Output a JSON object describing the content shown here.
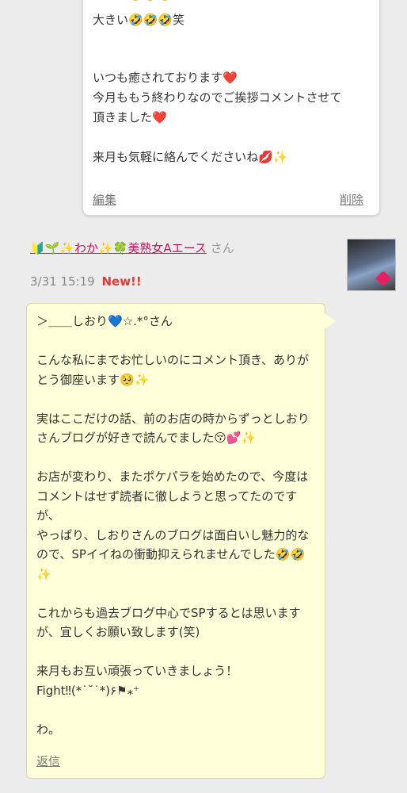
{
  "prev_comment": {
    "cut_line": "・・・🤣🤣🤣",
    "lines": [
      "大きい🤣🤣🤣笑",
      "",
      "",
      "いつも癒されております❤️",
      "今月ももう終わりなのでご挨拶コメントさせて",
      "頂きました❤️",
      "",
      "来月も気軽に絡んでくださいね💋✨"
    ],
    "edit_label": "編集",
    "delete_label": "削除"
  },
  "reply_comment": {
    "author_prefix": "🔰🌱✨わか✨🍀",
    "author_name": "美熟女Aエース",
    "author_suffix": "さん",
    "timestamp": "3/31 15:19",
    "new_badge": "New!!",
    "body": "＞＿＿しおり💙☆.*°さん\n\nこんな私にまでお忙しいのにコメント頂き、ありがとう御座います🥺✨\n\n実はここだけの話、前のお店の時からずっとしおりさんブログが好きで読んでました😚💕✨\n\nお店が変わり、またポケパラを始めたので、今度はコメントはせず読者に徹しようと思ってたのですが、\nやっぱり、しおりさんのブログは面白いし魅力的なので、SPイイねの衝動抑えられませんでした🤣🤣✨\n\nこれからも過去ブログ中心でSPするとは思いますが、宜しくお願い致します(笑)\n\n来月もお互い頑張っていきましょう！\nFight‼︎(*˙˘˙*)۶⚑⁎⁺\n\nわ。",
    "reply_label": "返信"
  }
}
